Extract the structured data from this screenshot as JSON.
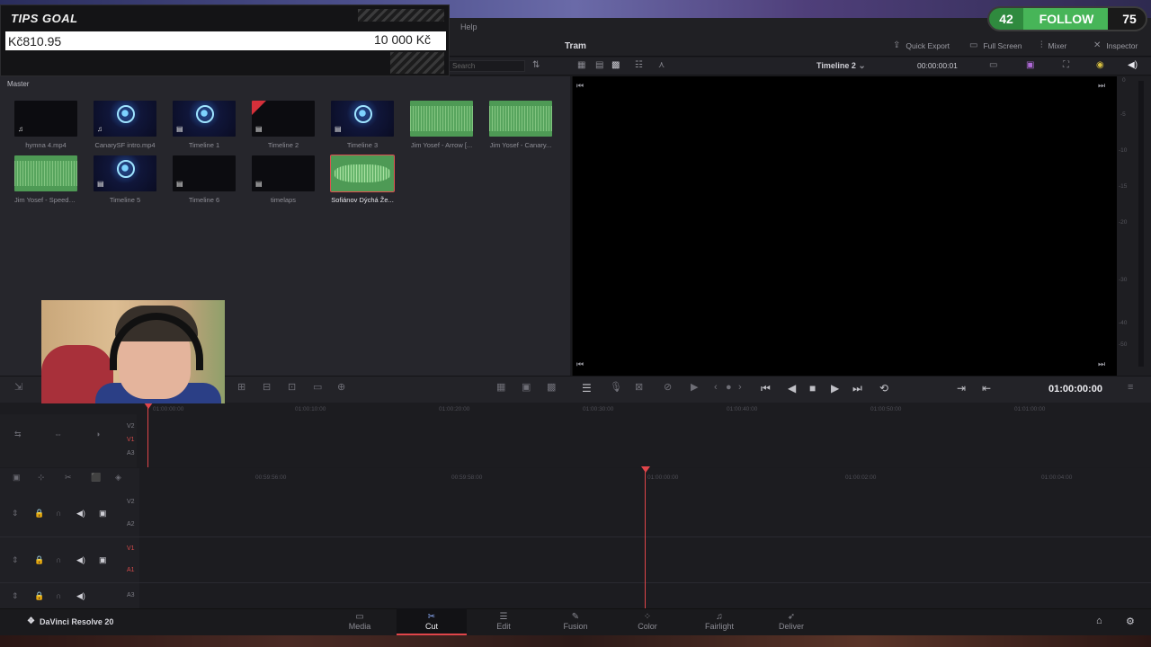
{
  "menu": {
    "help": "Help"
  },
  "header": {
    "project_title": "Tram",
    "quick_export": "Quick Export",
    "full_screen": "Full Screen",
    "mixer": "Mixer",
    "inspector": "Inspector"
  },
  "toolbar": {
    "search_placeholder": "Search",
    "timeline_select": "Timeline 2",
    "timecode_small": "00:00:00:01"
  },
  "media_pool": {
    "title": "Master",
    "clips": [
      {
        "name": "hymna 4.mp4",
        "kind": "video-audio"
      },
      {
        "name": "CanarySF intro.mp4",
        "kind": "scene"
      },
      {
        "name": "Timeline 1",
        "kind": "scene-timeline"
      },
      {
        "name": "Timeline 2",
        "kind": "timeline-flagged"
      },
      {
        "name": "Timeline 3",
        "kind": "scene-timeline"
      },
      {
        "name": "Jim Yosef - Arrow [...",
        "kind": "audio"
      },
      {
        "name": "Jim Yosef - Canary...",
        "kind": "audio"
      },
      {
        "name": "Jim Yosef - Speed [...",
        "kind": "audio"
      },
      {
        "name": "Timeline 5",
        "kind": "scene-timeline"
      },
      {
        "name": "Timeline 6",
        "kind": "timeline"
      },
      {
        "name": "timelaps",
        "kind": "timeline"
      },
      {
        "name": "Sofiánov Dýchá Že...",
        "kind": "audio-selected"
      }
    ]
  },
  "meter": {
    "db_labels": [
      "0",
      "-5",
      "-10",
      "-15",
      "-20",
      "-30",
      "-40",
      "-50"
    ]
  },
  "transport": {
    "timecode": "01:00:00:00"
  },
  "upper_timeline": {
    "ticks": [
      "01:00:00:00",
      "01:00:10:00",
      "01:00:20:00",
      "01:00:30:00",
      "01:00:40:00",
      "01:00:50:00",
      "01:01:00:00"
    ],
    "tracks": [
      "V2",
      "V1",
      "A3"
    ]
  },
  "lower_timeline": {
    "ticks": [
      "00:59:56:00",
      "00:59:58:00",
      "01:00:00:00",
      "01:00:02:00",
      "01:00:04:00"
    ],
    "tracks": [
      {
        "video": "V2",
        "audio": "A2"
      },
      {
        "video": "V1",
        "audio": "A1"
      },
      {
        "video": "",
        "audio": "A3"
      }
    ]
  },
  "pagebar": {
    "brand": "DaVinci Resolve 20",
    "pages": [
      "Media",
      "Cut",
      "Edit",
      "Fusion",
      "Color",
      "Fairlight",
      "Deliver"
    ],
    "active": "Cut"
  },
  "overlay_tips": {
    "title": "TIPS GOAL",
    "current": "Kč810.95",
    "target": "10 000 Kč"
  },
  "overlay_follow": {
    "count": "42",
    "label": "FOLLOW",
    "goal": "75"
  },
  "colors": {
    "accent_red": "#e0454a",
    "audio_green": "#4e9a55",
    "follow_green": "#47b558"
  }
}
